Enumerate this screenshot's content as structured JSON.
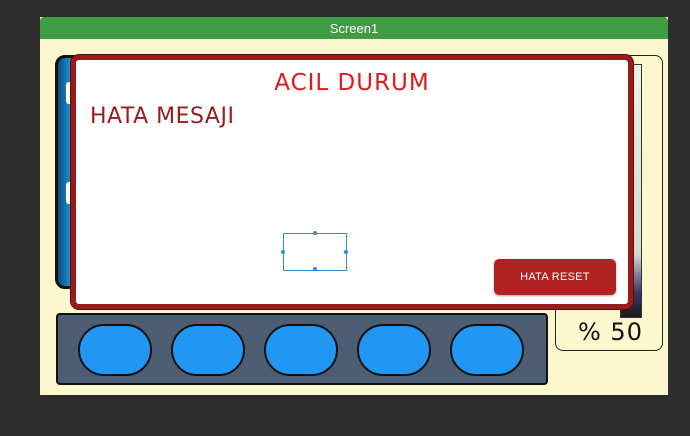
{
  "window": {
    "title": "Screen1"
  },
  "dialog": {
    "title": "ACIL DURUM",
    "message": "HATA MESAJI",
    "reset_label": "HATA RESET"
  },
  "gauge": {
    "percent_label": "% 50",
    "level_percent": 50
  },
  "button_bar": {
    "count": 5
  },
  "colors": {
    "titlebar": "#3e9c43",
    "dialog_border": "#9a1b1b",
    "title_text": "#e01b1b",
    "reset_button": "#b22222",
    "pill_button": "#2196f3",
    "screen_background": "#fdf7cf"
  }
}
